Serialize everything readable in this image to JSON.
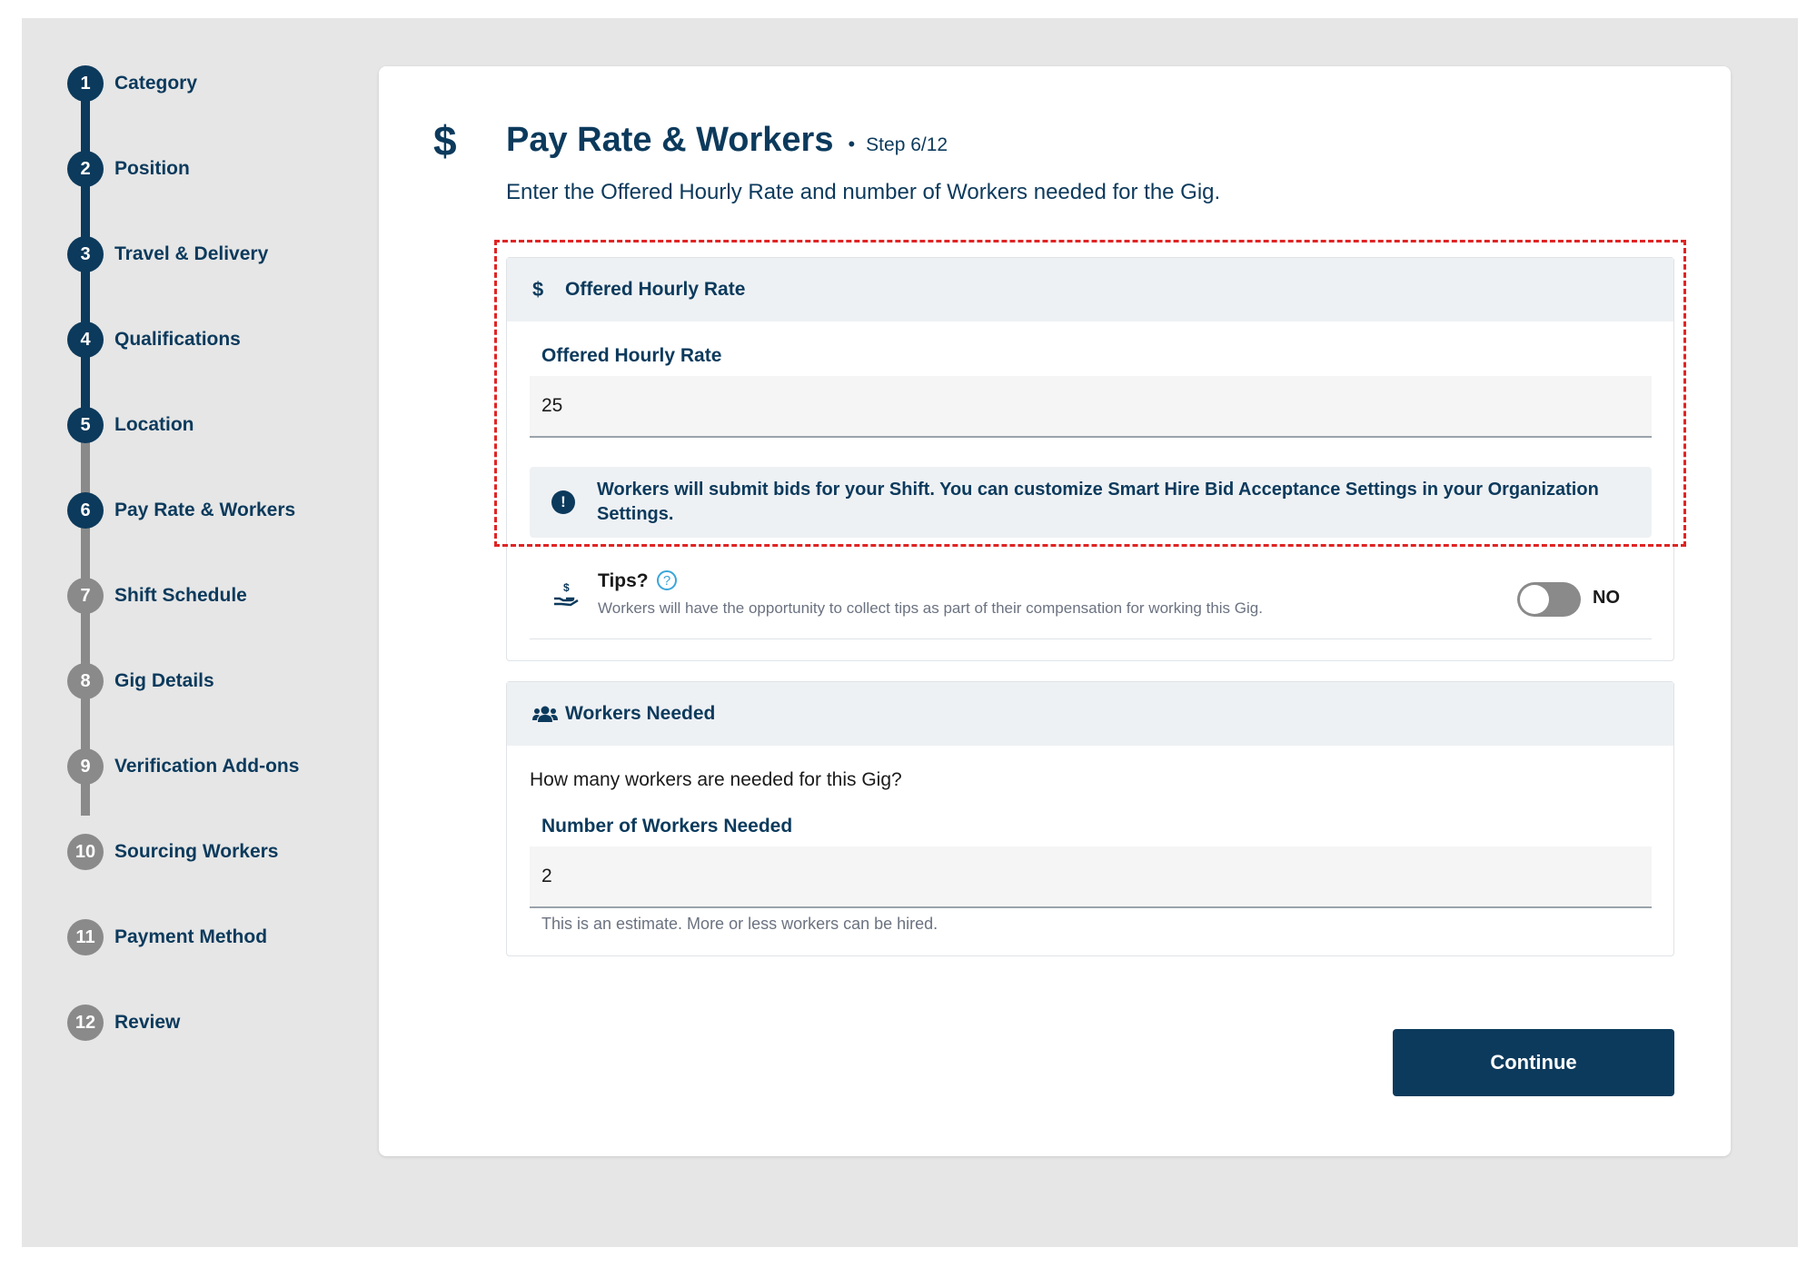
{
  "colors": {
    "active": "#0c3a5c",
    "inactive": "#8a8a8a",
    "highlight": "#e02424"
  },
  "steps": [
    {
      "num": "1",
      "label": "Category",
      "state": "completed"
    },
    {
      "num": "2",
      "label": "Position",
      "state": "completed"
    },
    {
      "num": "3",
      "label": "Travel & Delivery",
      "state": "completed"
    },
    {
      "num": "4",
      "label": "Qualifications",
      "state": "completed"
    },
    {
      "num": "5",
      "label": "Location",
      "state": "completed"
    },
    {
      "num": "6",
      "label": "Pay Rate & Workers",
      "state": "current"
    },
    {
      "num": "7",
      "label": "Shift Schedule",
      "state": "upcoming"
    },
    {
      "num": "8",
      "label": "Gig Details",
      "state": "upcoming"
    },
    {
      "num": "9",
      "label": "Verification Add-ons",
      "state": "upcoming"
    },
    {
      "num": "10",
      "label": "Sourcing Workers",
      "state": "upcoming"
    },
    {
      "num": "11",
      "label": "Payment Method",
      "state": "upcoming"
    },
    {
      "num": "12",
      "label": "Review",
      "state": "upcoming"
    }
  ],
  "header": {
    "icon": "dollar-icon",
    "icon_glyph": "$",
    "title": "Pay Rate & Workers",
    "separator": "•",
    "step_count": "Step 6/12",
    "subtitle": "Enter the Offered Hourly Rate and number of Workers needed for the Gig."
  },
  "rate_panel": {
    "icon": "dollar-icon",
    "icon_glyph": "$",
    "title": "Offered Hourly Rate",
    "field_label": "Offered Hourly Rate",
    "field_value": "25",
    "notice_icon": "exclamation-icon",
    "notice_glyph": "!",
    "notice_text": "Workers will submit bids for your Shift. You can customize Smart Hire Bid Acceptance Settings in your Organization Settings.",
    "tips_icon": "hand-coin-icon",
    "tips_title": "Tips?",
    "help_icon": "question-circle-icon",
    "help_glyph": "?",
    "tips_description": "Workers will have the opportunity to collect tips as part of their compensation for working this Gig.",
    "tips_toggle_on": false,
    "tips_toggle_label": "NO"
  },
  "workers_panel": {
    "icon": "users-icon",
    "title": "Workers Needed",
    "question": "How many workers are needed for this Gig?",
    "field_label": "Number of Workers Needed",
    "field_value": "2",
    "hint": "This is an estimate. More or less workers can be hired."
  },
  "continue_label": "Continue"
}
